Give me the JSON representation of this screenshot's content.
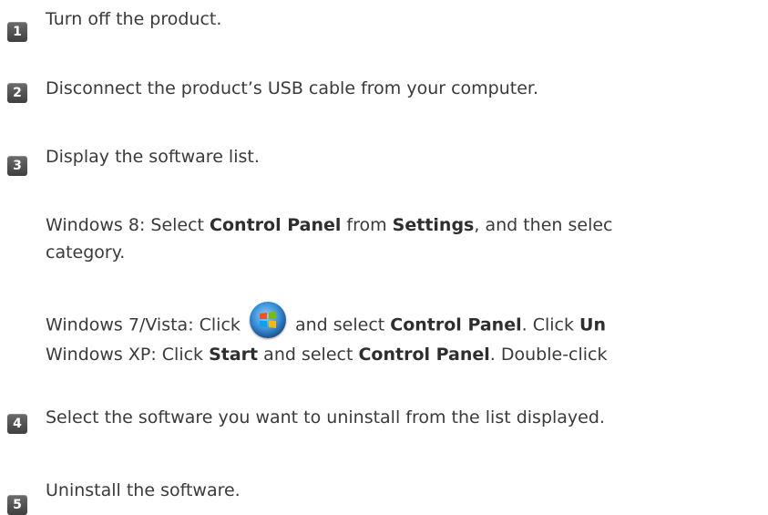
{
  "steps": [
    {
      "number": "1",
      "text": "Turn off the product."
    },
    {
      "number": "2",
      "text": "Disconnect the product’s USB cable from your computer."
    },
    {
      "number": "3",
      "text": "Display the software list."
    },
    {
      "number": "4",
      "text": "Select the software you want to uninstall from the list displayed."
    },
    {
      "number": "5",
      "text": "Uninstall the software."
    }
  ],
  "win8": {
    "prefix": "Windows 8: Select ",
    "control_panel": "Control Panel",
    "from": " from ",
    "settings": "Settings",
    "rest": ", and then selec",
    "line2": "category."
  },
  "win7": {
    "prefix": "Windows 7/Vista: Click ",
    "icon": "windows-start-orb-icon",
    "and_select": " and select ",
    "control_panel": "Control Panel",
    "click": ". Click ",
    "un": "Un"
  },
  "winxp": {
    "prefix": "Windows XP: Click ",
    "start": "Start",
    "and_select": " and select ",
    "control_panel": "Control Panel",
    "rest": ". Double-click"
  }
}
